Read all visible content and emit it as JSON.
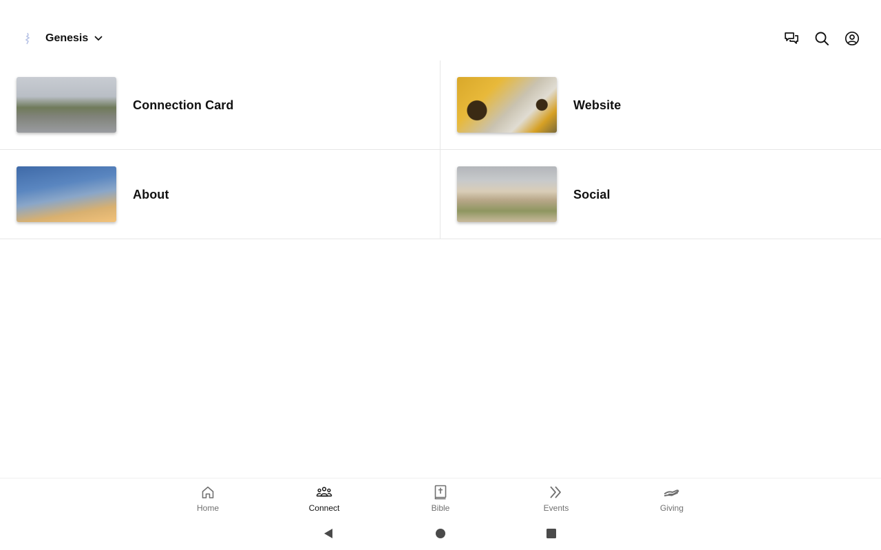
{
  "header": {
    "brand_name": "Genesis",
    "icons": [
      "chat-icon",
      "search-icon",
      "account-icon"
    ]
  },
  "cards": [
    {
      "label": "Connection Card",
      "thumb": "street-walkers-photo"
    },
    {
      "label": "Website",
      "thumb": "sunflowers-photo"
    },
    {
      "label": "About",
      "thumb": "sky-clouds-photo"
    },
    {
      "label": "Social",
      "thumb": "dunes-beach-photo"
    }
  ],
  "nav": {
    "items": [
      {
        "label": "Home",
        "icon": "home-icon"
      },
      {
        "label": "Connect",
        "icon": "people-icon",
        "active": true
      },
      {
        "label": "Bible",
        "icon": "bible-icon"
      },
      {
        "label": "Events",
        "icon": "double-chevron-icon"
      },
      {
        "label": "Giving",
        "icon": "giving-hand-icon"
      }
    ]
  },
  "colors": {
    "active_label": "#111111",
    "inactive_label": "#6f6f6f",
    "divider": "#e6e6e6"
  }
}
